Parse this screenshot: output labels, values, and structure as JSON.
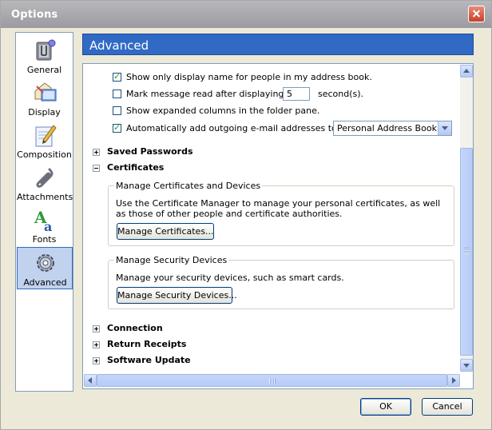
{
  "window": {
    "title": "Options"
  },
  "sidebar": {
    "items": [
      {
        "label": "General",
        "icon": "general-icon"
      },
      {
        "label": "Display",
        "icon": "display-icon"
      },
      {
        "label": "Composition",
        "icon": "composition-icon"
      },
      {
        "label": "Attachments",
        "icon": "attachments-icon"
      },
      {
        "label": "Fonts",
        "icon": "fonts-icon"
      },
      {
        "label": "Advanced",
        "icon": "gear-icon",
        "active": true
      }
    ]
  },
  "header": {
    "title": "Advanced"
  },
  "options": {
    "show_display_name": {
      "label": "Show only display name for people in my address book.",
      "checked": true
    },
    "mark_read": {
      "label": "Mark message read after displaying for",
      "value": "5",
      "suffix": "second(s).",
      "checked": false
    },
    "expanded_columns": {
      "label": "Show expanded columns in the folder pane.",
      "checked": false
    },
    "auto_add": {
      "label": "Automatically add outgoing e-mail addresses to my:",
      "checked": true,
      "select_value": "Personal Address Book"
    }
  },
  "sections": {
    "saved_passwords": "Saved Passwords",
    "certificates": "Certificates",
    "connection": "Connection",
    "return_receipts": "Return Receipts",
    "software_update": "Software Update"
  },
  "certificates": {
    "manage_group": {
      "title": "Manage Certificates and Devices",
      "text": "Use the Certificate Manager to manage your personal certificates, as well as those of other people and certificate authorities.",
      "button": "Manage Certificates..."
    },
    "security_group": {
      "title": "Manage Security Devices",
      "text": "Manage your security devices, such as smart cards.",
      "button": "Manage Security Devices..."
    }
  },
  "footer": {
    "ok": "OK",
    "cancel": "Cancel"
  },
  "colors": {
    "header_bg": "#316ac5",
    "selected_bg": "#c1d2ee",
    "title_bar": "#9a9aa0"
  }
}
